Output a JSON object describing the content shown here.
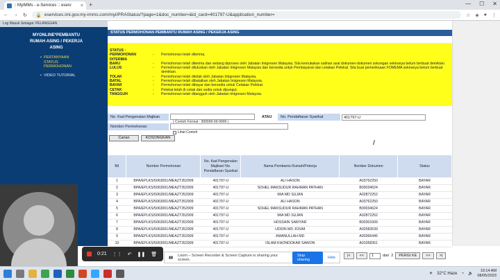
{
  "browser": {
    "tab_title": ":: MyIMMs - e-Services :: eserv",
    "url": "eservices.imi.gov.my-imms.com/myi/PRAStatus/?page=1&doc_number=&id_card=401797-U&application_number="
  },
  "sidebar": {
    "top_text": "Log Masuk Sebagai: PELANGGAN",
    "title": "MYONLINE*PEMBANTU RUMAH ASING / PEKERJA ASING",
    "items": [
      {
        "label": "PERTANYAAN STATUS PERMOHONAN"
      },
      {
        "label": "VIDEO TUTORIAL"
      }
    ]
  },
  "header": {
    "title": "STATUS PERMOHONAN PEMBANTU RUMAH ASING / PEKERJA ASING"
  },
  "status_legend": [
    {
      "key": "STATUS :",
      "dash": "",
      "value": ""
    },
    {
      "key": "PERMOHONAN DITERIMA",
      "dash": "-",
      "value": "Permohonan telah diterima."
    },
    {
      "key": "BARU",
      "dash": "-",
      "value": "Permohonan telah diterima dan sedang diproses oleh Jabatan Imigresen Malaysia. Sila kemukakan salinan asal dokumen-dokumen sokongan sekiranya belum berbuat demikian."
    },
    {
      "key": "LULUS",
      "dash": "-",
      "value": "Permohonan telah diluluskan oleh Jabatan Imigresen Malaysia dan bersedia untuk Pembayaran dan cetakan Pelekat. Sila buat pemeriksaan FOMEMA sekiranya belum berbuat demikian."
    },
    {
      "key": "TOLAK",
      "dash": "-",
      "value": "Permohonan telah ditolak oleh Jabatan Imigresen Malaysia."
    },
    {
      "key": "BATAL",
      "dash": "-",
      "value": "Permohonan telah dibatalkan oleh Jabatan Imigresen Malaysia."
    },
    {
      "key": "BAYAR",
      "dash": "-",
      "value": "Permohonan telah dibayar dan bersedia untuk Cetakan Pelekat."
    },
    {
      "key": "CETAK",
      "dash": "-",
      "value": "Pelekat telah di cetak dan sedia untuk dipungut."
    },
    {
      "key": "TANGGUH",
      "dash": "-",
      "value": "Permohonan telah ditangguh oleh Jabatan Imigresen Malaysia."
    }
  ],
  "form": {
    "kad_label": "No. Kad Pengenalan Majikan",
    "kad_value": "",
    "kad_hint": "( Contoh Format : 999999-99-9999 )",
    "atau": "ATAU",
    "daftar_label": "No. Pendaftaran Syarikat",
    "daftar_value": "401797-U",
    "permohonan_label": "Nombor Permohonan",
    "permohonan_value": "",
    "contoh_label": "Lihat Contoh",
    "cari_label": "Carian",
    "kosong_label": "KOSONGKAN"
  },
  "table": {
    "headers": [
      "Bil",
      "Nombor Permohonan",
      "No. Kad Pengenalan Majikan/ No. Pendaftaran Syarikat",
      "Nama Pembantu Rumah/Pekerja",
      "Nombor Dokumen",
      "Status"
    ],
    "rows": [
      [
        "1",
        "BPA/EPLKS/5063001/MEAZT352909",
        "401797-U",
        "ALI HASON",
        "A03762250",
        "BAYAR"
      ],
      [
        "2",
        "BPA/EPLKS/5063001/MEAZT352909",
        "401797-U",
        "SOHEL MAKSUDUR RAHMAN PATHAN",
        "B00034624",
        "BAYAR"
      ],
      [
        "3",
        "BPA/EPLKS/5063001/MEAZT352909",
        "401797-U",
        "MIA MD SUJAN",
        "A02872252",
        "BAYAR"
      ],
      [
        "4",
        "BPA/EPLKS/5063001/MEAZT352909",
        "401797-U",
        "ALI HASON",
        "A03762250",
        "BAYAR"
      ],
      [
        "5",
        "BPA/EPLKS/5063001/MEAZT352909",
        "401797-U",
        "SOHEL MAKSUDUR RAHMAN PATHAN",
        "B00034624",
        "BAYAR"
      ],
      [
        "6",
        "BPA/EPLKS/5063001/MEAZT352909",
        "401797-U",
        "MIA MD SUJAN",
        "A02872252",
        "BAYAR"
      ],
      [
        "7",
        "BPA/EPLKS/5063001/MEAZT352909",
        "401797-U",
        "HOSSAIN SARIYAR",
        "B00301609",
        "BAYAR"
      ],
      [
        "8",
        "BPA/EPLKS/5063001/MEAZT352909",
        "401797-U",
        "UDDIN MD JOSIM",
        "A02583539",
        "BAYAR"
      ],
      [
        "9",
        "BPA/EPLKS/5063001/MEAZT352909",
        "401797-U",
        "AMANULLAH MD",
        "A00366445",
        "BAYAR"
      ],
      [
        "10",
        "BPA/EPLKS/5063001/MEAZT352909",
        "401797-U",
        "ISLAM KHONDOKAR SAWON",
        "A01058361",
        "BAYAR"
      ]
    ]
  },
  "recorder": {
    "time": "0:21"
  },
  "share": {
    "text": "Loom – Screen Recorder & Screen Capture is sharing your screen.",
    "stop": "Stop sharing",
    "hide": "Hide"
  },
  "pager": {
    "first": "|<",
    "prev": "<<",
    "page": "1",
    "of": "dari",
    "total": "2",
    "goto": "PERGI KE",
    "next": ">>",
    "last": ">|"
  },
  "taskbar": {
    "weather": "32°C Haze",
    "time": "10:14 AM",
    "date": "08/05/2023"
  }
}
